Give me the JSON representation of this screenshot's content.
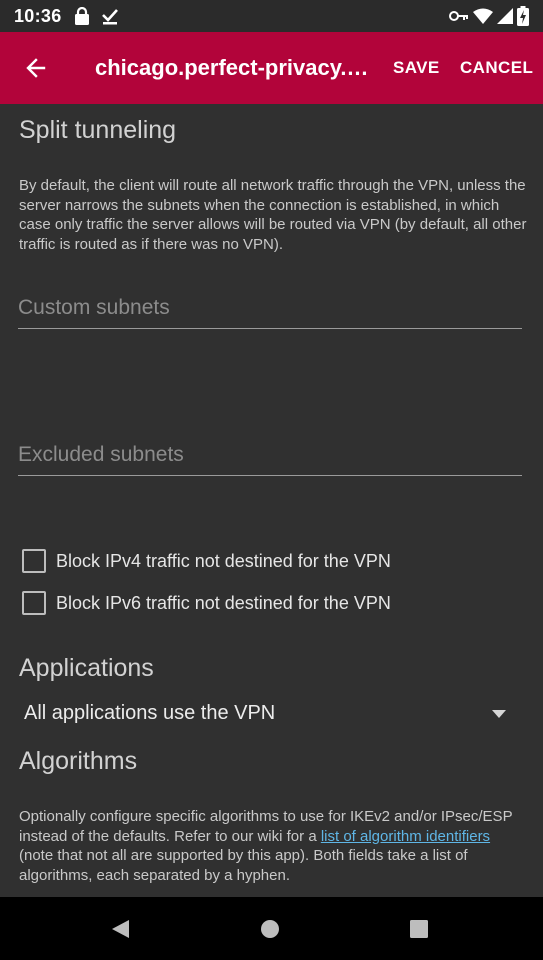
{
  "status_bar": {
    "time": "10:36",
    "left_icons": [
      "lock-icon",
      "download-done-icon"
    ],
    "right_icons": [
      "vpn-key-icon",
      "wifi-icon",
      "cell-signal-icon",
      "battery-charging-icon"
    ]
  },
  "app_bar": {
    "title": "chicago.perfect-privacy.com",
    "save_label": "SAVE",
    "cancel_label": "CANCEL",
    "color": "#b2043a"
  },
  "split_tunneling": {
    "title": "Split tunneling",
    "description": "By default, the client will route all network traffic through the VPN, unless the server narrows the subnets when the connection is established, in which case only traffic the server allows will be routed via VPN (by default, all other traffic is routed as if there was no VPN).",
    "custom_subnets_placeholder": "Custom subnets",
    "custom_subnets_value": "",
    "excluded_subnets_placeholder": "Excluded subnets",
    "excluded_subnets_value": "",
    "block_ipv4_label": "Block IPv4 traffic not destined for the VPN",
    "block_ipv6_label": "Block IPv6 traffic not destined for the VPN"
  },
  "applications": {
    "title": "Applications",
    "selected": "All applications use the VPN"
  },
  "algorithms": {
    "title": "Algorithms",
    "desc_part1": "Optionally configure specific algorithms to use for IKEv2 and/or IPsec/ESP instead of the defaults. Refer to our wiki for a ",
    "desc_link": "list of algorithm identifiers",
    "desc_part2": " (note that not all are supported by this app). Both fields take a list of algorithms, each separated by a hyphen."
  },
  "nav_bar": {
    "icons": [
      "back-triangle-icon",
      "home-circle-icon",
      "recents-square-icon"
    ]
  }
}
